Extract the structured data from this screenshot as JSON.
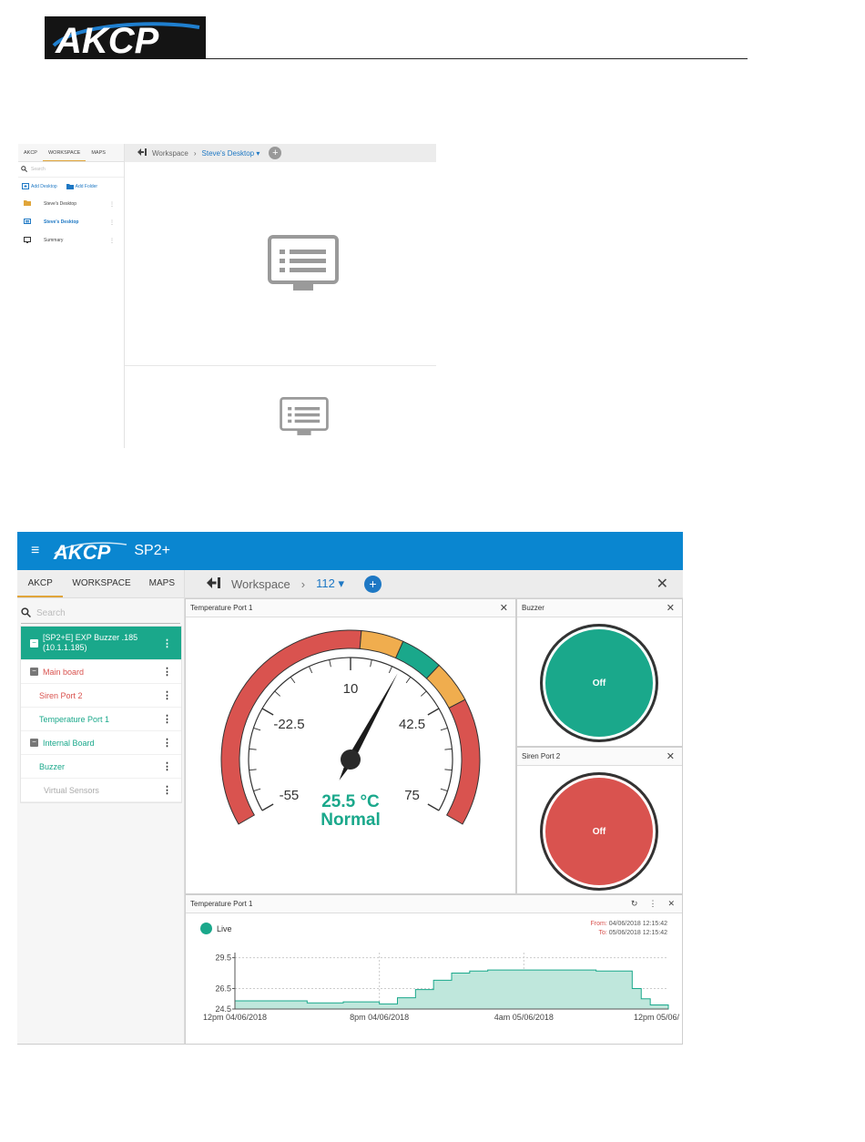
{
  "brand": {
    "logo_text": "AKCP",
    "product": "SP2+"
  },
  "small_shot": {
    "tabs": [
      "AKCP",
      "WORKSPACE",
      "MAPS"
    ],
    "active_tab": "WORKSPACE",
    "search_placeholder": "Search",
    "add_desktop": "Add Desktop",
    "add_folder": "Add Folder",
    "items": [
      {
        "label": "Steve's Desktop",
        "icon": "folder-icon"
      },
      {
        "label": "Steve's Desktop",
        "icon": "desktop-icon",
        "selected": true
      },
      {
        "label": "Summary",
        "icon": "monitor-icon"
      }
    ],
    "breadcrumb": {
      "root": "Workspace",
      "current": "Steve's Desktop ▾"
    }
  },
  "app": {
    "tabs": [
      "AKCP",
      "WORKSPACE",
      "MAPS"
    ],
    "search_placeholder": "Search",
    "tree": {
      "root": {
        "line1": "[SP2+E] EXP Buzzer .185",
        "line2": "(10.1.1.185)"
      },
      "main_board": "Main board",
      "siren_port": "Siren Port 2",
      "temp_port": "Temperature Port 1",
      "internal_board": "Internal Board",
      "buzzer": "Buzzer",
      "virtual": "Virtual Sensors"
    },
    "breadcrumb": {
      "root": "Workspace",
      "current": "112 ▾"
    },
    "gauge": {
      "title": "Temperature Port 1",
      "min": -55,
      "max": 75,
      "ticks": [
        "-55",
        "-22.5",
        "10",
        "42.5",
        "75"
      ],
      "value": 25.5,
      "value_text": "25.5 °C",
      "status": "Normal",
      "colors": {
        "normal": "#1aa88b",
        "warning": "#f0ad4e",
        "critical": "#d9534f"
      }
    },
    "buzzer": {
      "title": "Buzzer",
      "state": "Off",
      "color": "#1aa88b"
    },
    "siren": {
      "title": "Siren Port 2",
      "state": "Off",
      "color": "#d9534f"
    },
    "graph": {
      "title": "Temperature Port 1",
      "legend": "Live",
      "from_label": "From:",
      "from_value": "04/06/2018 12:15:42",
      "to_label": "To:",
      "to_value": "05/06/2018 12:15:42"
    }
  },
  "chart_data": {
    "type": "area",
    "title": "Temperature Port 1",
    "series": [
      {
        "name": "Live",
        "color": "#1aa88b"
      }
    ],
    "yticks": [
      "24.5",
      "26.5",
      "29.5"
    ],
    "ylim": [
      24.5,
      30.0
    ],
    "xticks": [
      "12pm 04/06/2018",
      "8pm 04/06/2018",
      "4am 05/06/2018",
      "12pm 05/06/"
    ],
    "x_hours": [
      0,
      2,
      4,
      6,
      8,
      9,
      10,
      11,
      12,
      13,
      14,
      14.5,
      15,
      16,
      18,
      20,
      22,
      22.5,
      23,
      24
    ],
    "y_values": [
      25.3,
      25.3,
      25.1,
      25.2,
      25.0,
      25.6,
      26.4,
      27.3,
      28.0,
      28.2,
      28.3,
      28.3,
      28.3,
      28.3,
      28.3,
      28.2,
      26.5,
      25.5,
      24.9,
      24.9
    ],
    "grid": true
  }
}
